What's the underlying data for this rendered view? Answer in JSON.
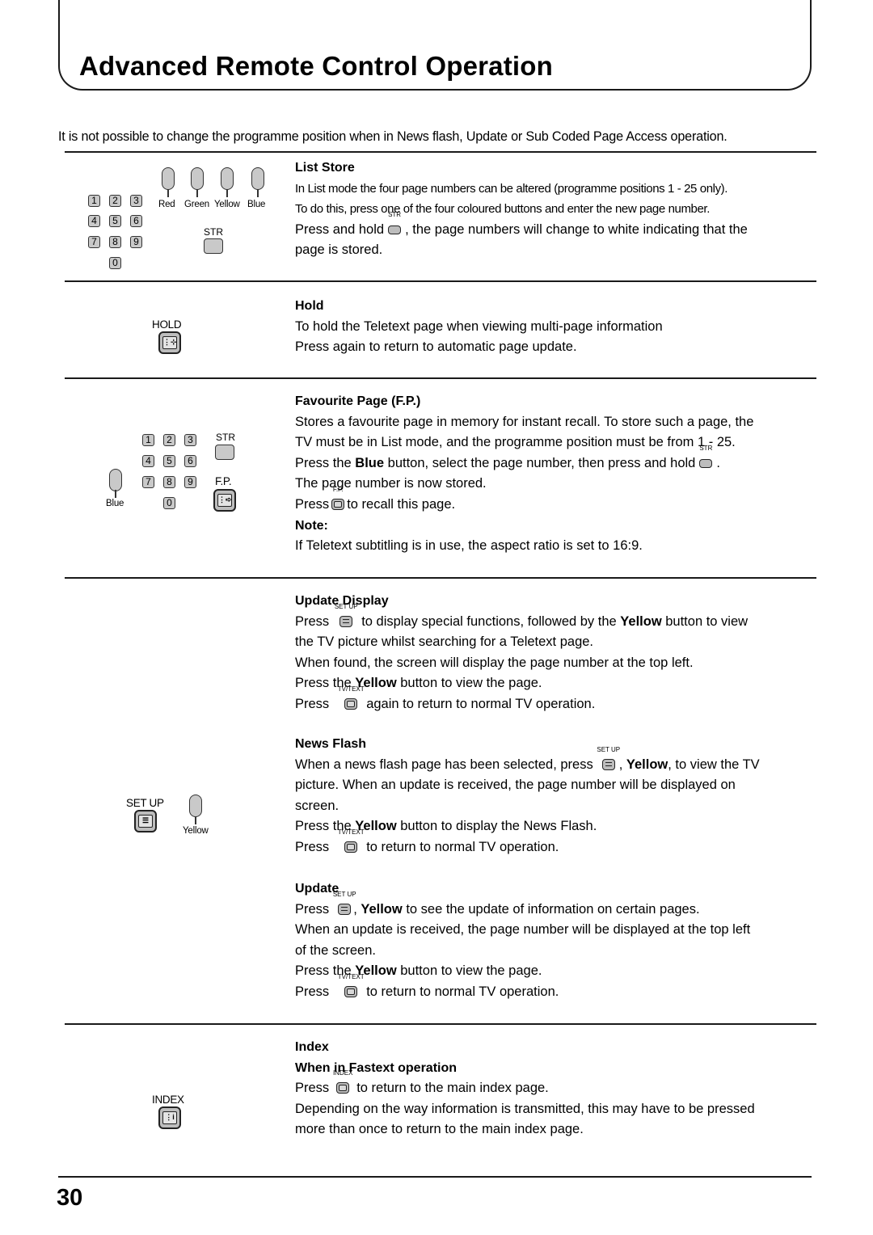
{
  "header": {
    "title": "Advanced Remote Control Operation"
  },
  "intro": "It is not possible to change the programme position when in News flash, Update or Sub Coded Page Access operation.",
  "keypad_digits": [
    "1",
    "2",
    "3",
    "4",
    "5",
    "6",
    "7",
    "8",
    "9",
    "0"
  ],
  "remote_labels": {
    "red": "Red",
    "green": "Green",
    "yellow": "Yellow",
    "blue": "Blue",
    "str": "STR",
    "hold": "HOLD",
    "fp": "F.P.",
    "setup": "SET UP",
    "index": "INDEX",
    "tvtext": "TV/TEXT"
  },
  "sections": {
    "list_store": {
      "heading": "List Store",
      "lines": [
        "In List mode the four page numbers can be altered (programme positions 1 - 25 only).",
        "To do this, press one of the four coloured buttons and enter the new page number.",
        "Press and hold",
        ", the page numbers will change to white indicating that the",
        "page is stored."
      ]
    },
    "hold": {
      "heading": "Hold",
      "lines": [
        "To hold the Teletext page when viewing multi-page information",
        "Press again to return to automatic page update."
      ]
    },
    "favourite_page": {
      "heading": "Favourite Page (F.P.)",
      "lines": [
        "Stores a favourite page in memory for instant recall. To store such a page, the",
        "TV must be in List mode, and the programme position must be from 1 - 25.",
        "Press the",
        "Blue",
        "button, select the page number, then press and hold",
        ".",
        "The page number is now stored.",
        "Press",
        "to recall this page."
      ],
      "note_heading": "Note:",
      "note_text": "If Teletext subtitling is in use, the aspect ratio is set to 16:9."
    },
    "update_display": {
      "heading": "Update Display",
      "press": "Press",
      "l1_after": "to display special functions, followed by the",
      "yellow": "Yellow",
      "l1_end": "button to view",
      "l2": "the TV picture whilst searching for a Teletext page.",
      "l3": "When found, the screen will display the page number at the top left.",
      "l4_a": "Press the",
      "l4_b": "button to view the page.",
      "l5_after": "again to return to normal TV operation."
    },
    "news_flash": {
      "heading": "News Flash",
      "l1_a": "When a news flash page has been selected, press",
      "l1_b": ", ",
      "yellow": "Yellow",
      "l1_c": ", to view the TV",
      "l2": "picture. When an update is received, the page number will be displayed on",
      "l3": "screen.",
      "l4_a": "Press the",
      "l4_b": "button to display the News Flash.",
      "press": "Press",
      "l5_after": "to return to normal TV operation."
    },
    "update": {
      "heading": "Update",
      "press": "Press",
      "l1_b": ", ",
      "yellow": "Yellow",
      "l1_c": "to see the update of information on certain pages.",
      "l2": "When an update is received, the page number will be displayed at the top left",
      "l3": "of the screen.",
      "l4_a": "Press the",
      "l4_b": "button to view the page.",
      "l5_after": "to return to normal TV operation."
    },
    "index": {
      "heading": "Index",
      "subheading": "When in Fastext operation",
      "press": "Press",
      "l1_after": "to return to the main index page.",
      "l2": "Depending on the way information is transmitted, this may have to be pressed",
      "l3": "more than once to return to the main index page."
    }
  },
  "footer": {
    "page_number": "30"
  }
}
